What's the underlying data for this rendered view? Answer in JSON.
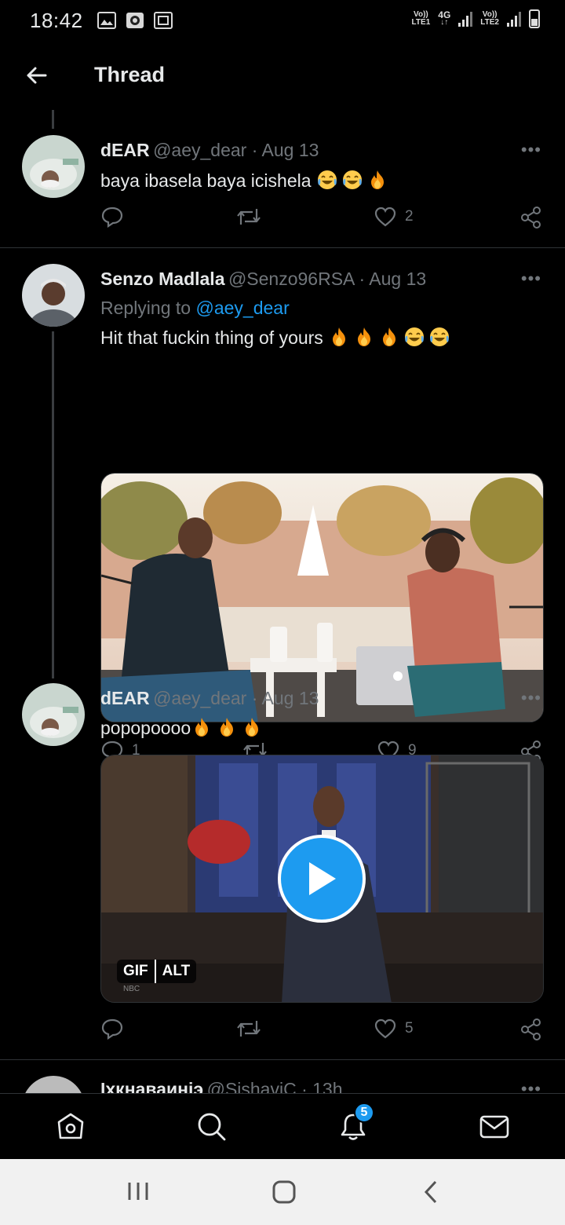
{
  "status_bar": {
    "time": "18:42",
    "icons_left": [
      "gallery-icon",
      "app-icon",
      "screenshot-icon"
    ],
    "sim1_top": "Vo))",
    "sim1_bottom": "LTE1",
    "net_type": "4G",
    "net_arrows": "↓↑",
    "sim2_top": "Vo))",
    "sim2_bottom": "LTE2"
  },
  "header": {
    "title": "Thread"
  },
  "tweets": [
    {
      "name": "dEAR",
      "meta": "@aey_dear · Aug 13",
      "text": "baya ibasela baya icishela",
      "emojis": [
        "laugh-cry",
        "laugh-cry",
        "fire"
      ],
      "actions": {
        "replies": "",
        "retweets": "",
        "likes": "2"
      }
    },
    {
      "name": "Senzo Madlala",
      "meta": "@Senzo96RSA · Aug 13",
      "replying_prefix": "Replying to ",
      "replying_to": "@aey_dear",
      "text": "Hit that fuckin thing of yours",
      "emojis": [
        "fire",
        "fire",
        "fire",
        "laugh-cry",
        "laugh-cry"
      ],
      "actions": {
        "replies": "1",
        "retweets": "",
        "likes": "9"
      }
    },
    {
      "name": "dEAR",
      "meta": "@aey_dear · Aug 13",
      "text": "popopoooo",
      "emojis": [
        "fire",
        "fire",
        "fire"
      ],
      "media_badges": [
        "GIF",
        "ALT"
      ],
      "media_watermark": "NBC",
      "actions": {
        "replies": "",
        "retweets": "",
        "likes": "5"
      }
    },
    {
      "name": "Ixкнаваиніэ",
      "meta": "@SishaviC · 13h"
    }
  ],
  "bottom_nav": {
    "notifications_count": "5"
  },
  "colors": {
    "accent": "#1d9bf0",
    "muted": "#71767b",
    "text": "#e7e9ea",
    "bg": "#000000"
  }
}
